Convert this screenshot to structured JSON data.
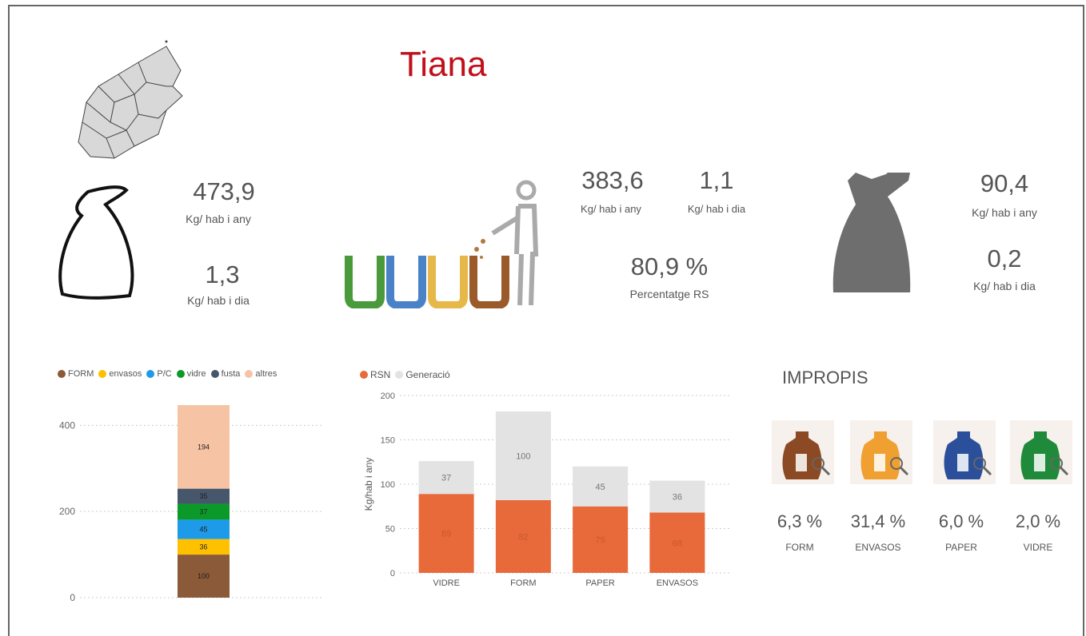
{
  "title": "Tiana",
  "stats_left": {
    "year_value": "473,9",
    "year_unit": "Kg/ hab i any",
    "day_value": "1,3",
    "day_unit": "Kg/ hab i dia"
  },
  "stats_mid": {
    "year_value": "383,6",
    "year_unit": "Kg/ hab i any",
    "day_value": "1,1",
    "day_unit": "Kg/ hab i dia",
    "pct_value": "80,9 %",
    "pct_label": "Percentatge RS"
  },
  "stats_right": {
    "year_value": "90,4",
    "year_unit": "Kg/ hab i any",
    "day_value": "0,2",
    "day_unit": "Kg/ hab i dia"
  },
  "impropis": {
    "title": "IMPROPIS",
    "items": [
      {
        "pct": "6,3 %",
        "label": "FORM",
        "color": "#8b4a23"
      },
      {
        "pct": "31,4 %",
        "label": "ENVASOS",
        "color": "#f0a030"
      },
      {
        "pct": "6,0 %",
        "label": "PAPER",
        "color": "#2b4f9a"
      },
      {
        "pct": "2,0 %",
        "label": "VIDRE",
        "color": "#1f8a3a"
      }
    ]
  },
  "chart_data": [
    {
      "type": "bar",
      "stacked": true,
      "legend_position": "top-left",
      "series": [
        {
          "name": "FORM",
          "color": "#8b5a38",
          "values": [
            100
          ]
        },
        {
          "name": "envasos",
          "color": "#ffc000",
          "values": [
            36
          ]
        },
        {
          "name": "P/C",
          "color": "#1e9be8",
          "values": [
            45
          ]
        },
        {
          "name": "vidre",
          "color": "#0b9a2a",
          "values": [
            37
          ]
        },
        {
          "name": "fusta",
          "color": "#46566b",
          "values": [
            35
          ]
        },
        {
          "name": "altres",
          "color": "#f6c4a5",
          "values": [
            194
          ]
        }
      ],
      "yticks": [
        "0",
        "200",
        "400"
      ],
      "ylim": [
        0,
        460
      ],
      "grid": true
    },
    {
      "type": "bar",
      "stacked": true,
      "legend_position": "top-left",
      "categories": [
        "VIDRE",
        "FORM",
        "PAPER",
        "ENVASOS"
      ],
      "series": [
        {
          "name": "RSN",
          "color": "#e8693a",
          "values": [
            89,
            82,
            75,
            68
          ]
        },
        {
          "name": "Generació",
          "color": "#e3e3e3",
          "values": [
            37,
            100,
            45,
            36
          ]
        }
      ],
      "ylabel": "Kg/hab i any",
      "yticks": [
        "0",
        "50",
        "100",
        "150",
        "200"
      ],
      "ylim": [
        0,
        200
      ],
      "grid": true
    }
  ]
}
